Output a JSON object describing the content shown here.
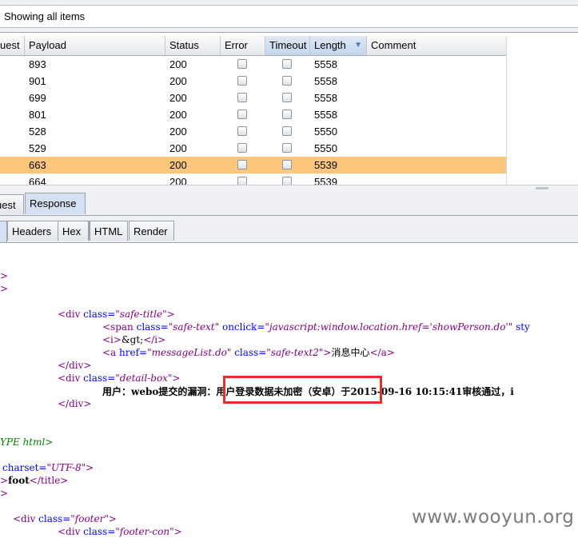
{
  "filter": {
    "text": "Showing all items"
  },
  "table": {
    "columns": [
      "uest",
      "Payload",
      "Status",
      "Error",
      "Timeout",
      "Length",
      "Comment"
    ],
    "sorted_column": "Length",
    "sort_direction": "descending",
    "rows": [
      {
        "payload": "893",
        "status": "200",
        "length": "5558"
      },
      {
        "payload": "901",
        "status": "200",
        "length": "5558"
      },
      {
        "payload": "699",
        "status": "200",
        "length": "5558"
      },
      {
        "payload": "801",
        "status": "200",
        "length": "5558"
      },
      {
        "payload": "528",
        "status": "200",
        "length": "5550"
      },
      {
        "payload": "529",
        "status": "200",
        "length": "5550"
      },
      {
        "payload": "663",
        "status": "200",
        "length": "5539",
        "selected": true
      },
      {
        "payload": "664",
        "status": "200",
        "length": "5539"
      }
    ]
  },
  "tabs_top": {
    "request_partial": "uest",
    "response": "Response",
    "active": "Response"
  },
  "tabs_view": {
    "headers": "Headers",
    "hex": "Hex",
    "html": "HTML",
    "render": "Render"
  },
  "code": {
    "l1": ">",
    "l2": ">",
    "l3_tag_open": "<div ",
    "l3_attr": "class=",
    "l3_val": "\"safe-title\"",
    "l3_close": ">",
    "l4_open": "<span ",
    "l4_attr1": "class=",
    "l4_val1": "\"safe-text\"",
    "l4_attr2": " onclick=",
    "l4_val2": "\"javascript:window.location.href='showPerson.do'\"",
    "l4_tail": " sty",
    "l5_open": "<i>",
    "l5_text": "&gt;",
    "l5_close": "</i>",
    "l6_open": "<a ",
    "l6_attr1": "href=",
    "l6_val1": "\"messageList.do\"",
    "l6_attr2": " class=",
    "l6_val2": "\"safe-text2\"",
    "l6_gt": ">",
    "l6_text": "消息中心",
    "l6_close": "</a>",
    "l7": "</div>",
    "l8_open": "<div ",
    "l8_attr": "class=",
    "l8_val": "\"detail-box\"",
    "l8_close": ">",
    "l9_text1": "用户：webo提交的漏洞：",
    "l9_text2": "用户登录数据未加密（安卓）",
    "l9_text3": "于2015-09-16 10:15:41审核通过，i",
    "l10": "</div>",
    "l11": "YPE html>",
    "l12_attr": "charset=",
    "l12_val": "\"UTF-8\"",
    "l12_close": ">",
    "l13_gt": ">",
    "l13_text": "foot",
    "l13_close": "</title>",
    "l14": ">",
    "l15_open": "<div ",
    "l15_attr": "class=",
    "l15_val": "\"footer\"",
    "l15_close": ">",
    "l16_open": "<div ",
    "l16_attr": "class=",
    "l16_val": "\"footer-con\"",
    "l16_close": ">"
  },
  "watermark": "www.wooyun.org",
  "colors": {
    "selected_row": "#fdc77b",
    "highlight_border": "#ee2b2b",
    "tag": "#800080",
    "attr": "#0000ff"
  }
}
